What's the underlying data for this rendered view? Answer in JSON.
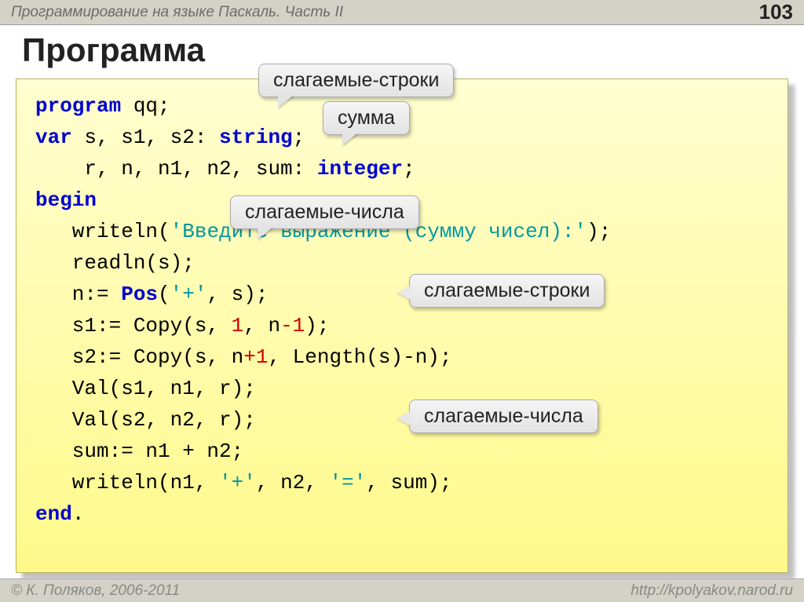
{
  "header": {
    "breadcrumb": "Программирование на языке Паскаль. Часть II",
    "page_number": "103"
  },
  "title": "Программа",
  "code": {
    "l1_kw": "program",
    "l1_rest": " qq;",
    "l2_kw": "var",
    "l2_rest": " s, s1, s2: ",
    "l2_type": "string",
    "l2_semi": ";",
    "l3_indent": "    r, n, n1, n2, sum: ",
    "l3_type": "integer",
    "l3_semi": ";",
    "l4_kw": "begin",
    "l5a": "   writeln(",
    "l5_str": "'Введите выражение (сумму чисел):'",
    "l5b": ");",
    "l6": "   readln(s);",
    "l7a": "   n:= ",
    "l7_fn": "Pos",
    "l7b": "(",
    "l7_str": "'+'",
    "l7c": ", s);",
    "l8a": "   s1:= Copy(s, ",
    "l8_n1": "1",
    "l8b": ", n",
    "l8_minus": "-",
    "l8_n2": "1",
    "l8c": ");",
    "l9a": "   s2:= Copy(s, n",
    "l9_plus": "+",
    "l9_n": "1",
    "l9b": ", Length(s)-n);",
    "l10": "   Val(s1, n1, r);",
    "l11": "   Val(s2, n2, r);",
    "l12": "   sum:= n1 + n2;",
    "l13a": "   writeln(n1, ",
    "l13_s1": "'+'",
    "l13b": ", n2, ",
    "l13_s2": "'='",
    "l13c": ", sum);",
    "l14_kw": "end",
    "l14_dot": "."
  },
  "callouts": {
    "c1": "слагаемые-строки",
    "c2": "сумма",
    "c3": "слагаемые-числа",
    "c4": "слагаемые-строки",
    "c5": "слагаемые-числа"
  },
  "footer": {
    "left": "© К. Поляков, 2006-2011",
    "right": "http://kpolyakov.narod.ru"
  }
}
